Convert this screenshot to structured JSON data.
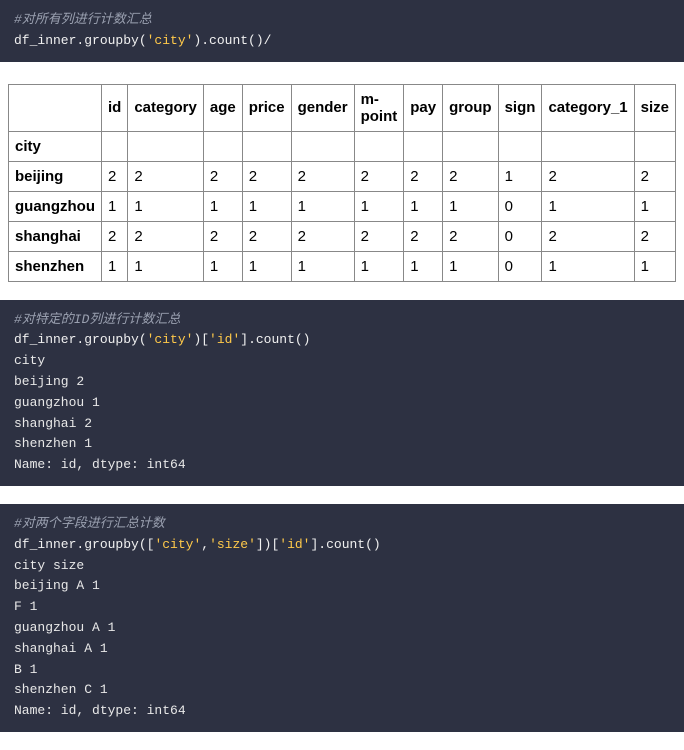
{
  "block1": {
    "comment": "#对所有列进行计数汇总",
    "code_parts": {
      "p1": "df_inner.groupby(",
      "p2": "'city'",
      "p3": ").count()/"
    }
  },
  "table": {
    "index_label": "city",
    "columns": [
      "id",
      "category",
      "age",
      "price",
      "gender",
      "m-point",
      "pay",
      "group",
      "sign",
      "category_1",
      "size"
    ],
    "rows": [
      {
        "city": "beijing",
        "vals": [
          "2",
          "2",
          "2",
          "2",
          "2",
          "2",
          "2",
          "2",
          "1",
          "2",
          "2"
        ]
      },
      {
        "city": "guangzhou",
        "vals": [
          "1",
          "1",
          "1",
          "1",
          "1",
          "1",
          "1",
          "1",
          "0",
          "1",
          "1"
        ]
      },
      {
        "city": "shanghai",
        "vals": [
          "2",
          "2",
          "2",
          "2",
          "2",
          "2",
          "2",
          "2",
          "0",
          "2",
          "2"
        ]
      },
      {
        "city": "shenzhen",
        "vals": [
          "1",
          "1",
          "1",
          "1",
          "1",
          "1",
          "1",
          "1",
          "0",
          "1",
          "1"
        ]
      }
    ]
  },
  "block2": {
    "comment": "#对特定的ID列进行计数汇总",
    "code_parts": {
      "p1": "df_inner.groupby(",
      "p2": "'city'",
      "p3": ")[",
      "p4": "'id'",
      "p5": "].count()"
    },
    "out": [
      "city",
      "beijing 2",
      "guangzhou 1",
      "shanghai 2",
      "shenzhen 1",
      "Name: id, dtype: int64"
    ]
  },
  "block3": {
    "comment": "#对两个字段进行汇总计数",
    "code_parts": {
      "p1": "df_inner.groupby([",
      "p2": "'city'",
      "p3": ",",
      "p4": "'size'",
      "p5": "])[",
      "p6": "'id'",
      "p7": "].count()"
    },
    "out": [
      "city size",
      "beijing A 1",
      "F 1",
      "guangzhou A 1",
      "shanghai A 1",
      "B 1",
      "shenzhen C 1",
      "Name: id, dtype: int64"
    ]
  }
}
